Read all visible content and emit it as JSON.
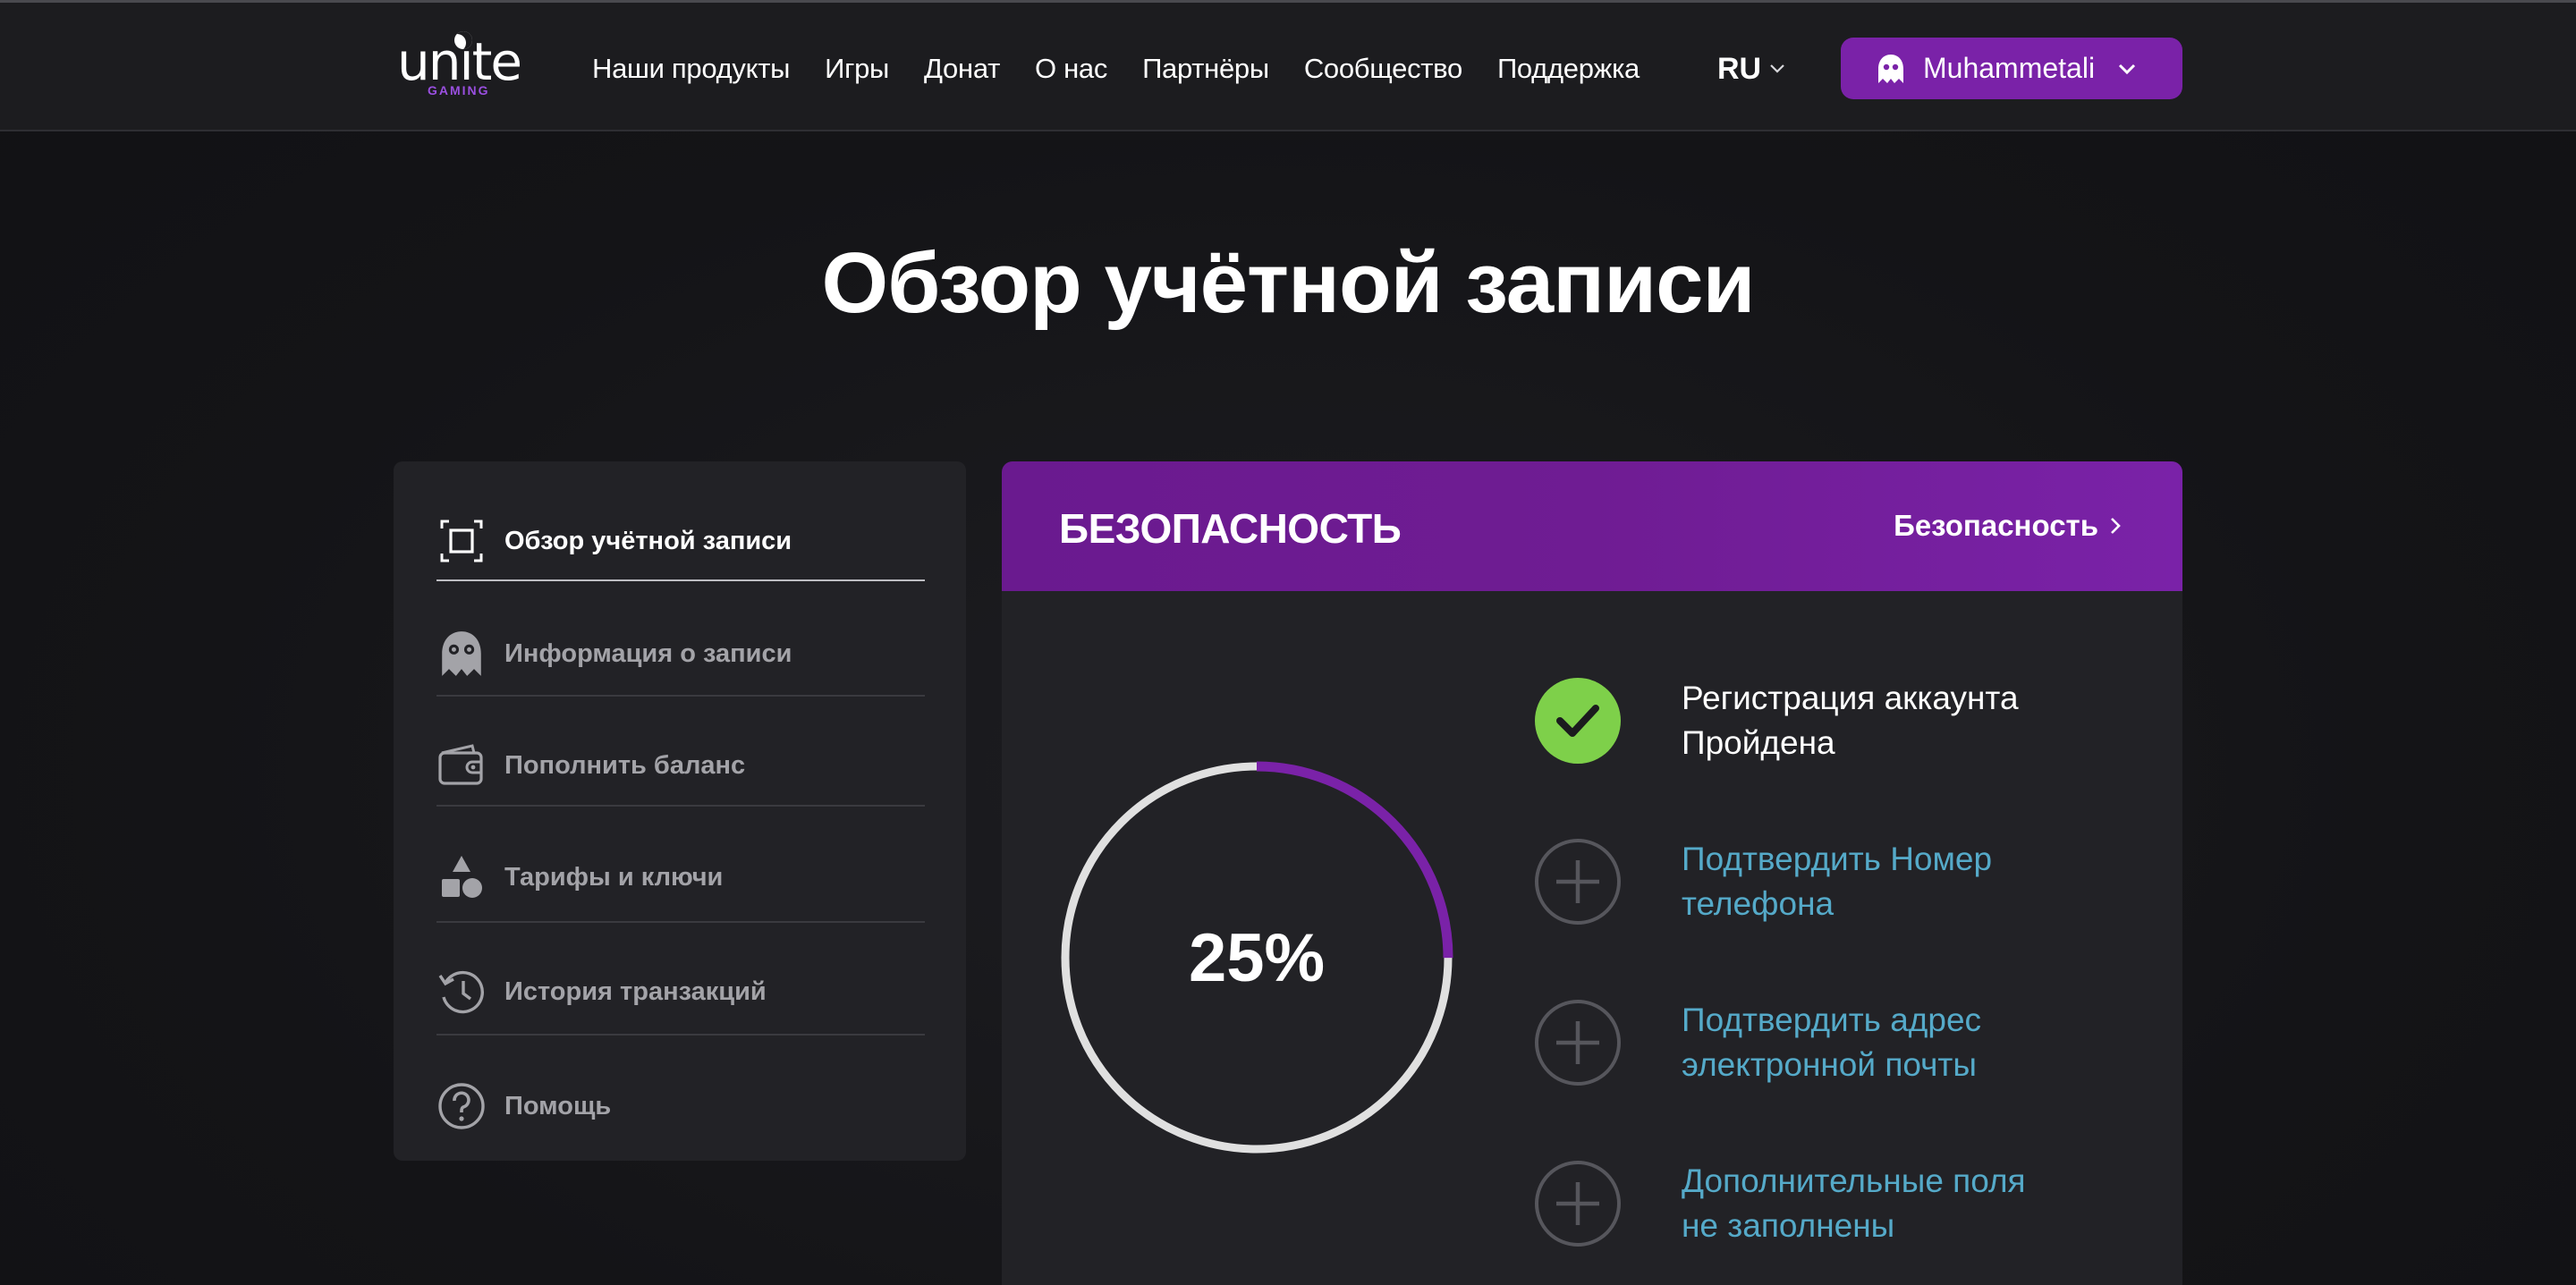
{
  "header": {
    "logo_word": "unite",
    "logo_sub": "GAMING",
    "nav": [
      "Наши продукты",
      "Игры",
      "Донат",
      "О нас",
      "Партнёры",
      "Сообщество",
      "Поддержка"
    ],
    "language": "RU",
    "user_name": "Muhammetali"
  },
  "page_title": "Обзор учётной записи",
  "sidebar": {
    "items": [
      {
        "label": "Обзор учётной записи",
        "icon": "overview-frame-icon",
        "active": true
      },
      {
        "label": "Информация о записи",
        "icon": "ghost-icon",
        "active": false
      },
      {
        "label": "Пополнить баланс",
        "icon": "wallet-icon",
        "active": false
      },
      {
        "label": "Тарифы и ключи",
        "icon": "shapes-icon",
        "active": false
      },
      {
        "label": "История транзакций",
        "icon": "history-icon",
        "active": false
      },
      {
        "label": "Помощь",
        "icon": "help-circle-icon",
        "active": false
      }
    ]
  },
  "security": {
    "title": "БЕЗОПАСНОСТЬ",
    "link_label": "Безопасность",
    "progress_label": "25%",
    "progress": 0.25,
    "steps": [
      {
        "text": "Регистрация аккаунта\nПройдена",
        "done": true
      },
      {
        "text": "Подтвердить Номер\nтелефона",
        "done": false
      },
      {
        "text": "Подтвердить адрес\nэлектронной почты",
        "done": false
      },
      {
        "text": "Дополнительные поля\nне заполнены",
        "done": false
      }
    ]
  },
  "colors": {
    "accent": "#7a22a8",
    "success": "#7ed04a",
    "link": "#55aac9",
    "ring_track": "#e0e0e0"
  }
}
